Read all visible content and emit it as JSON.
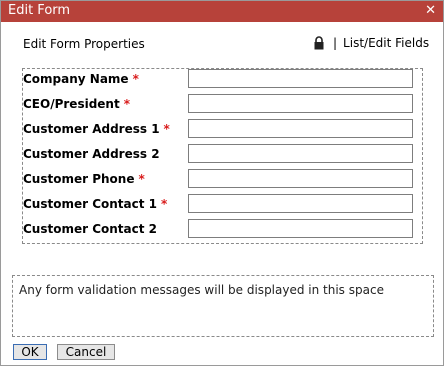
{
  "window": {
    "title": "Edit Form",
    "close_glyph": "✕"
  },
  "header": {
    "properties_label": "Edit Form Properties",
    "lock_icon": "lock-icon",
    "separator": "|",
    "list_edit_link": "List/Edit Fields"
  },
  "fields": [
    {
      "label": "Company Name",
      "required": true,
      "value": ""
    },
    {
      "label": "CEO/President",
      "required": true,
      "value": ""
    },
    {
      "label": "Customer Address 1",
      "required": true,
      "value": ""
    },
    {
      "label": "Customer Address 2",
      "required": false,
      "value": ""
    },
    {
      "label": "Customer Phone",
      "required": true,
      "value": ""
    },
    {
      "label": "Customer Contact 1",
      "required": true,
      "value": ""
    },
    {
      "label": "Customer Contact 2",
      "required": false,
      "value": ""
    }
  ],
  "required_marker": "*",
  "validation": {
    "message": "Any form validation messages will be displayed in this space"
  },
  "buttons": {
    "ok": "OK",
    "cancel": "Cancel"
  },
  "colors": {
    "titlebar": "#b7423a",
    "required": "#d91c1c"
  }
}
